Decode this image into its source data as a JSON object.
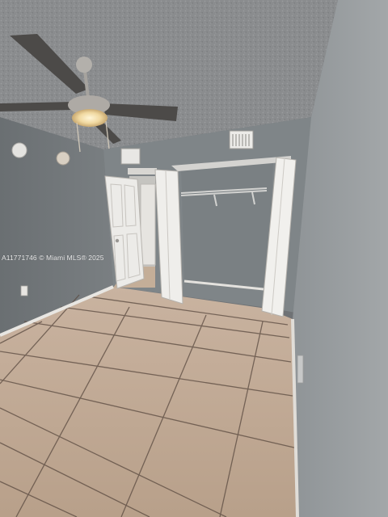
{
  "watermark": {
    "text": "A11771746 © Miami MLS® 2025"
  }
}
